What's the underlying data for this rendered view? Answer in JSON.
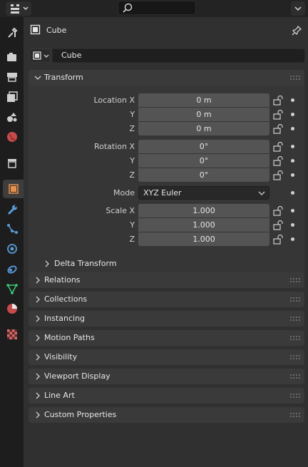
{
  "header": {
    "editor_icon": "properties-editor-icon",
    "search_placeholder": "",
    "options_icon": "chevron-down-icon"
  },
  "tabs": [
    {
      "name": "tool",
      "icon": "wrench-screwdriver-icon"
    },
    {
      "name": "render",
      "icon": "camera-back-icon"
    },
    {
      "name": "output",
      "icon": "printer-icon"
    },
    {
      "name": "view-layer",
      "icon": "image-stack-icon"
    },
    {
      "name": "scene",
      "icon": "scene-icon"
    },
    {
      "name": "world",
      "icon": "world-icon"
    },
    {
      "name": "collection",
      "icon": "collection-box-icon"
    },
    {
      "name": "object",
      "icon": "object-square-icon",
      "active": true
    },
    {
      "name": "modifiers",
      "icon": "wrench-icon"
    },
    {
      "name": "particles",
      "icon": "particles-icon"
    },
    {
      "name": "physics",
      "icon": "physics-orbit-icon"
    },
    {
      "name": "constraints",
      "icon": "constraint-icon"
    },
    {
      "name": "data",
      "icon": "mesh-data-icon"
    },
    {
      "name": "material",
      "icon": "material-sphere-icon"
    },
    {
      "name": "texture",
      "icon": "checker-texture-icon"
    }
  ],
  "object": {
    "title": "Cube",
    "name_value": "Cube"
  },
  "transform": {
    "title": "Transform",
    "location": {
      "label_x": "Location X",
      "label_y": "Y",
      "label_z": "Z",
      "x": "0 m",
      "y": "0 m",
      "z": "0 m"
    },
    "rotation": {
      "label_x": "Rotation X",
      "label_y": "Y",
      "label_z": "Z",
      "x": "0°",
      "y": "0°",
      "z": "0°"
    },
    "mode": {
      "label": "Mode",
      "value": "XYZ Euler"
    },
    "scale": {
      "label_x": "Scale X",
      "label_y": "Y",
      "label_z": "Z",
      "x": "1.000",
      "y": "1.000",
      "z": "1.000"
    },
    "delta": "Delta Transform"
  },
  "panels": [
    "Relations",
    "Collections",
    "Instancing",
    "Motion Paths",
    "Visibility",
    "Viewport Display",
    "Line Art",
    "Custom Properties"
  ],
  "colors": {
    "accent_object": "#e8904b",
    "panel_bg": "#3a3a3a",
    "field_bg": "#545454"
  }
}
